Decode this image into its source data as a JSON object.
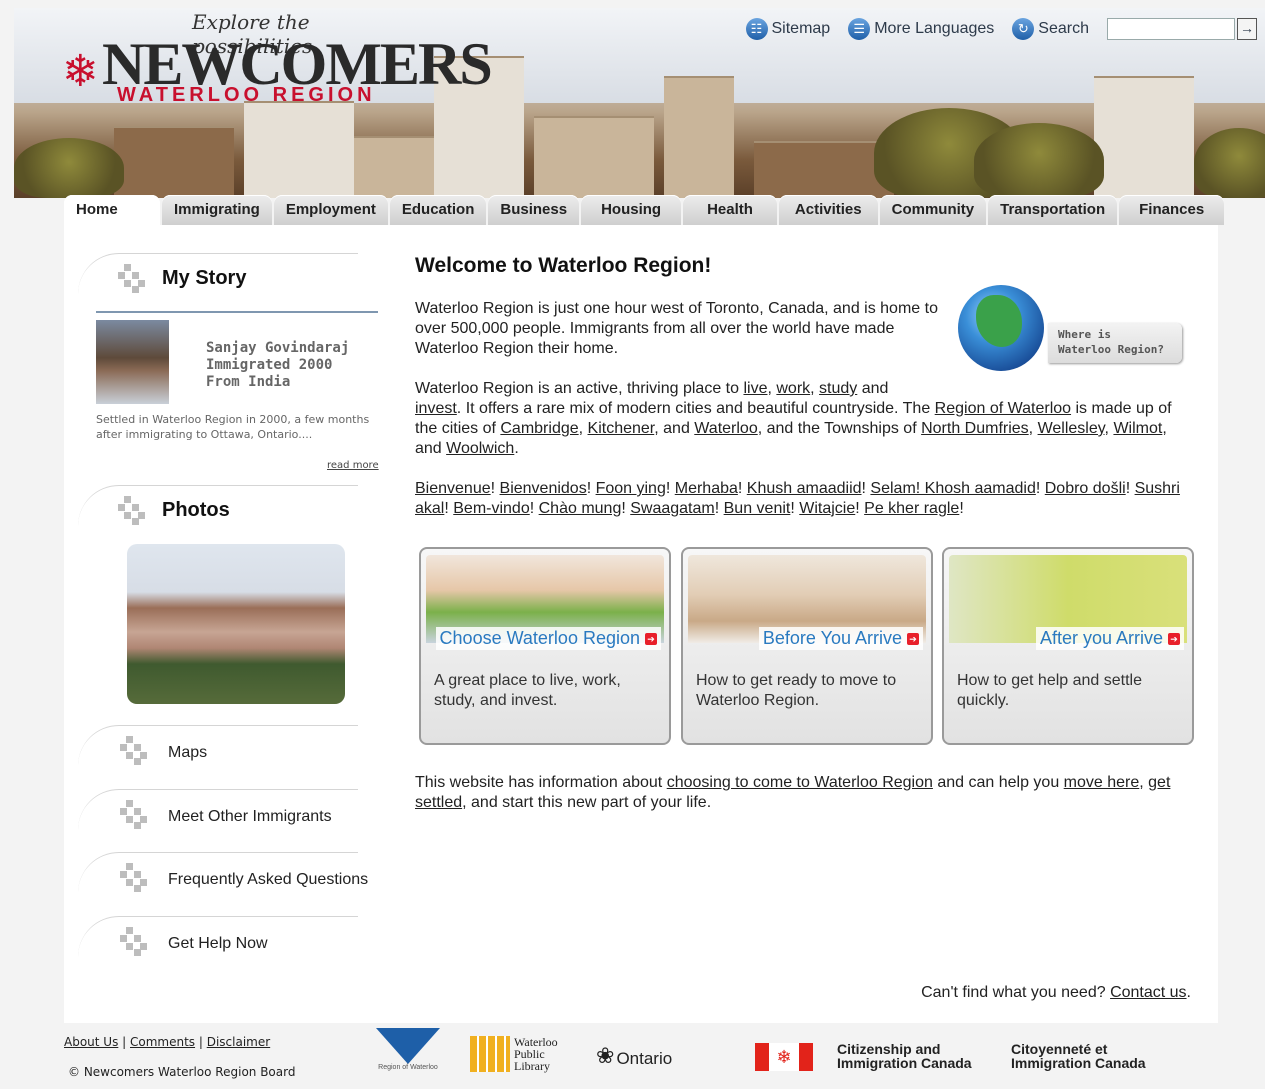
{
  "header": {
    "tagline": "Explore the possibilities",
    "logo_name": "NEWCOMERS",
    "logo_region": "WATERLOO REGION",
    "links": [
      {
        "label": "Sitemap",
        "icon": "sitemap-icon"
      },
      {
        "label": "More Languages",
        "icon": "languages-icon"
      },
      {
        "label": "Search",
        "icon": "search-icon"
      }
    ],
    "search_go": "→"
  },
  "tabs": [
    "Home",
    "Immigrating",
    "Employment",
    "Education",
    "Business",
    "Housing",
    "Health",
    "Activities",
    "Community",
    "Transportation",
    "Finances"
  ],
  "sidebar": {
    "my_story_title": "My Story",
    "story_name": "Sanjay Govindaraj",
    "story_year": "Immigrated 2000",
    "story_from": "From India",
    "story_text": "Settled in Waterloo Region in 2000, a few months after immigrating to Ottawa, Ontario....",
    "read_more": "read more",
    "photos_title": "Photos",
    "links": [
      "Maps",
      "Meet Other Immigrants",
      "Frequently Asked Questions",
      "Get Help Now"
    ]
  },
  "main": {
    "title": "Welcome to Waterloo Region!",
    "p1": "Waterloo Region is just one hour west of Toronto, Canada, and is home to over 500,000 people. Immigrants from all over the world have made Waterloo Region their home.",
    "where_label_1": "Where is",
    "where_label_2": "Waterloo Region?",
    "p2": {
      "t1": "Waterloo Region is an active, thriving place to ",
      "live": "live",
      "c1": ", ",
      "work": "work",
      "c2": ", ",
      "study": "study",
      "t2": " and ",
      "invest": "invest",
      "t3": ". It offers a rare mix of modern cities and beautiful countryside. The ",
      "region": "Region of Waterloo",
      "t4": " is made up of the cities of ",
      "cambridge": "Cambridge",
      "c3": ", ",
      "kitchener": "Kitchener",
      "c4": ", and ",
      "waterloo": "Waterloo",
      "t5": ", and the Townships of ",
      "north_dumfries": "North Dumfries",
      "c5": ", ",
      "wellesley": "Wellesley",
      "c6": ", ",
      "wilmot": "Wilmot",
      "c7": ", and ",
      "woolwich": "Woolwich",
      "t6": "."
    },
    "greetings": [
      "Bienvenue",
      "Bienvenidos",
      "Foon ying",
      "Merhaba",
      "Khush amaadiid",
      "Selam! Khosh aamadid",
      "Dobro došli",
      "Sushri akal",
      "Bem-vindo",
      "Chào mung",
      "Swaagatam",
      "Bun venit",
      "Witajcie",
      "Pe kher ragle"
    ],
    "cards": [
      {
        "title": "Choose Waterloo Region",
        "desc": "A great place to live, work, study, and invest."
      },
      {
        "title": "Before You Arrive",
        "desc": "How to get ready to move to Waterloo Region."
      },
      {
        "title": "After you Arrive",
        "desc": "How to get help and settle quickly."
      }
    ],
    "p4": {
      "t1": "This website has information about ",
      "l1": "choosing to come to Waterloo Region",
      "t2": " and can help you ",
      "l2": "move here",
      "t3": ", ",
      "l3": "get settled",
      "t4": ", and start this new part of your life."
    },
    "cant_find": "Can't find what you need? ",
    "contact": "Contact us",
    "cant_find_end": "."
  },
  "footer": {
    "about": "About Us",
    "comments": "Comments",
    "disclaimer": "Disclaimer",
    "sep": " | ",
    "copyright": "© Newcomers Waterloo Region Board",
    "logo_region": "Region of Waterloo",
    "logo_library_1": "Waterloo",
    "logo_library_2": "Public",
    "logo_library_3": "Library",
    "logo_ontario": "Ontario",
    "cic_en_1": "Citizenship and",
    "cic_en_2": "Immigration Canada",
    "cic_fr_1": "Citoyenneté et",
    "cic_fr_2": "Immigration Canada"
  }
}
